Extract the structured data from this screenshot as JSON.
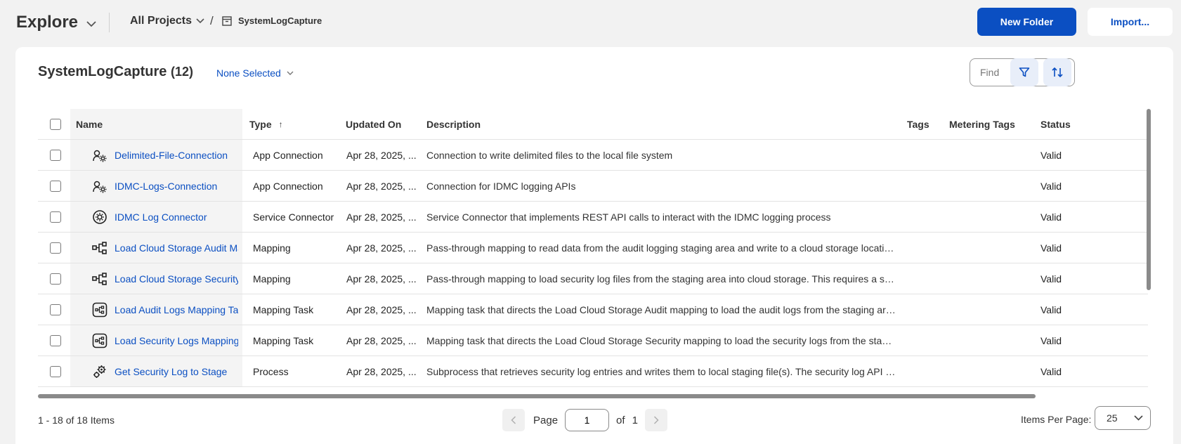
{
  "header": {
    "app_title": "Explore",
    "breadcrumb_projects": "All Projects",
    "breadcrumb_separator": "/",
    "breadcrumb_current": "SystemLogCapture",
    "new_folder_label": "New Folder",
    "import_label": "Import..."
  },
  "panel": {
    "title": "SystemLogCapture",
    "count": "12",
    "selection_label": "None Selected",
    "find_placeholder": "Find"
  },
  "table": {
    "columns": {
      "name": "Name",
      "type": "Type",
      "updated": "Updated On",
      "description": "Description",
      "tags": "Tags",
      "metering_tags": "Metering Tags",
      "status": "Status"
    },
    "rows": [
      {
        "icon": "app-connection-icon",
        "name": "Delimited-File-Connection",
        "type": "App Connection",
        "updated": "Apr 28, 2025, ...",
        "description": "Connection to write delimited files to the local file system",
        "tags": "",
        "metering_tags": "",
        "status": "Valid"
      },
      {
        "icon": "app-connection-icon",
        "name": "IDMC-Logs-Connection",
        "type": "App Connection",
        "updated": "Apr 28, 2025, ...",
        "description": "Connection for IDMC logging APIs",
        "tags": "",
        "metering_tags": "",
        "status": "Valid"
      },
      {
        "icon": "service-connector-icon",
        "name": "IDMC Log Connector",
        "type": "Service Connector",
        "updated": "Apr 28, 2025, ...",
        "description": "Service Connector that implements REST API calls to interact with the IDMC logging process",
        "tags": "",
        "metering_tags": "",
        "status": "Valid"
      },
      {
        "icon": "mapping-icon",
        "name": "Load Cloud Storage Audit Map",
        "type": "Mapping",
        "updated": "Apr 28, 2025, ...",
        "description": "Pass-through mapping to read data from the audit logging staging area and write to a cloud storage location. This...",
        "tags": "",
        "metering_tags": "",
        "status": "Valid"
      },
      {
        "icon": "mapping-icon",
        "name": "Load Cloud Storage Security M",
        "type": "Mapping",
        "updated": "Apr 28, 2025, ...",
        "description": "Pass-through mapping to load security log files from the staging area into cloud storage. This requires a separate ...",
        "tags": "",
        "metering_tags": "",
        "status": "Valid"
      },
      {
        "icon": "mapping-task-icon",
        "name": "Load Audit Logs Mapping Task",
        "type": "Mapping Task",
        "updated": "Apr 28, 2025, ...",
        "description": "Mapping task that directs the Load Cloud Storage Audit mapping to load the audit logs from the staging area to t...",
        "tags": "",
        "metering_tags": "",
        "status": "Valid"
      },
      {
        "icon": "mapping-task-icon",
        "name": "Load Security Logs Mapping Ta",
        "type": "Mapping Task",
        "updated": "Apr 28, 2025, ...",
        "description": "Mapping task that directs the Load Cloud Storage Security mapping to load the security logs from the staging are...",
        "tags": "",
        "metering_tags": "",
        "status": "Valid"
      },
      {
        "icon": "process-icon",
        "name": "Get Security Log to Stage",
        "type": "Process",
        "updated": "Apr 28, 2025, ...",
        "description": "Subprocess that retrieves security log entries and writes them to local staging file(s). The security log API can onl...",
        "tags": "",
        "metering_tags": "",
        "status": "Valid"
      }
    ]
  },
  "footer": {
    "items_summary": "1 - 18 of 18 Items",
    "page_label": "Page",
    "page_value": "1",
    "of_label": "of",
    "total_pages": "1",
    "items_per_page_label": "Items Per Page:",
    "items_per_page_value": "25"
  },
  "colors": {
    "accent": "#0b4fc2",
    "background": "#f2f2f2"
  }
}
